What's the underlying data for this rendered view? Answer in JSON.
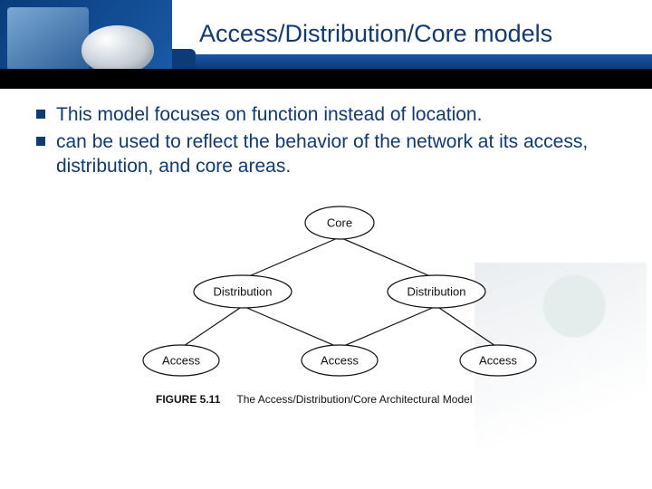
{
  "title": "Access/Distribution/Core models",
  "bullets": [
    "This model focuses on function instead of location.",
    "can be used to reflect the behavior of the network at its access, distribution, and core areas."
  ],
  "figure": {
    "number": "FIGURE 5.11",
    "caption": "The Access/Distribution/Core Architectural Model",
    "nodes": {
      "core": "Core",
      "dist_left": "Distribution",
      "dist_right": "Distribution",
      "acc_left": "Access",
      "acc_mid": "Access",
      "acc_right": "Access"
    }
  }
}
